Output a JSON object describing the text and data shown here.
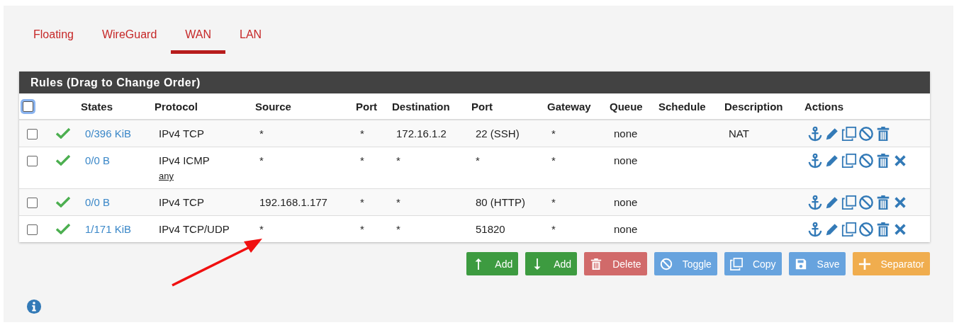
{
  "tabs": [
    {
      "label": "Floating",
      "selected": false
    },
    {
      "label": "WireGuard",
      "selected": false
    },
    {
      "label": "WAN",
      "selected": true
    },
    {
      "label": "LAN",
      "selected": false
    }
  ],
  "rules_panel": {
    "title": "Rules (Drag to Change Order)",
    "select_all": {
      "checked": false
    },
    "columns": [
      "States",
      "Protocol",
      "Source",
      "Port",
      "Destination",
      "Port",
      "Gateway",
      "Queue",
      "Schedule",
      "Description",
      "Actions"
    ],
    "rows": [
      {
        "checked": false,
        "enabled": true,
        "states": "0/396 KiB",
        "protocol": "IPv4 TCP",
        "source": "*",
        "source_port": "*",
        "destination": "172.16.1.2",
        "destination_port": "22 (SSH)",
        "gateway": "*",
        "queue": "none",
        "description": "NAT",
        "has_clear_action": false
      },
      {
        "checked": false,
        "enabled": true,
        "states": "0/0 B",
        "protocol": "IPv4 ICMP",
        "protocol_detail": "any",
        "source": "*",
        "source_port": "*",
        "destination": "*",
        "destination_port": "*",
        "gateway": "*",
        "queue": "none",
        "has_clear_action": true
      },
      {
        "checked": false,
        "enabled": true,
        "states": "0/0 B",
        "protocol": "IPv4 TCP",
        "source": "192.168.1.177",
        "source_port": "*",
        "destination": "*",
        "destination_port": "80 (HTTP)",
        "gateway": "*",
        "queue": "none",
        "has_clear_action": true
      },
      {
        "checked": false,
        "enabled": true,
        "states": "1/171 KiB",
        "protocol": "IPv4 TCP/UDP",
        "source": "*",
        "source_port": "*",
        "destination": "*",
        "destination_port": "51820",
        "gateway": "*",
        "queue": "none",
        "has_clear_action": true
      }
    ]
  },
  "buttons": [
    {
      "kind": "add-above",
      "label": "Add",
      "color": "#3d9b40"
    },
    {
      "kind": "add-below",
      "label": "Add",
      "color": "#3d9b40"
    },
    {
      "kind": "delete",
      "label": "Delete",
      "color": "#d16a6a"
    },
    {
      "kind": "toggle",
      "label": "Toggle",
      "color": "#67a3de"
    },
    {
      "kind": "copy",
      "label": "Copy",
      "color": "#67a3de"
    },
    {
      "kind": "save",
      "label": "Save",
      "color": "#67a3de"
    },
    {
      "kind": "separator",
      "label": "Separator",
      "color": "#f0ad4e"
    }
  ]
}
